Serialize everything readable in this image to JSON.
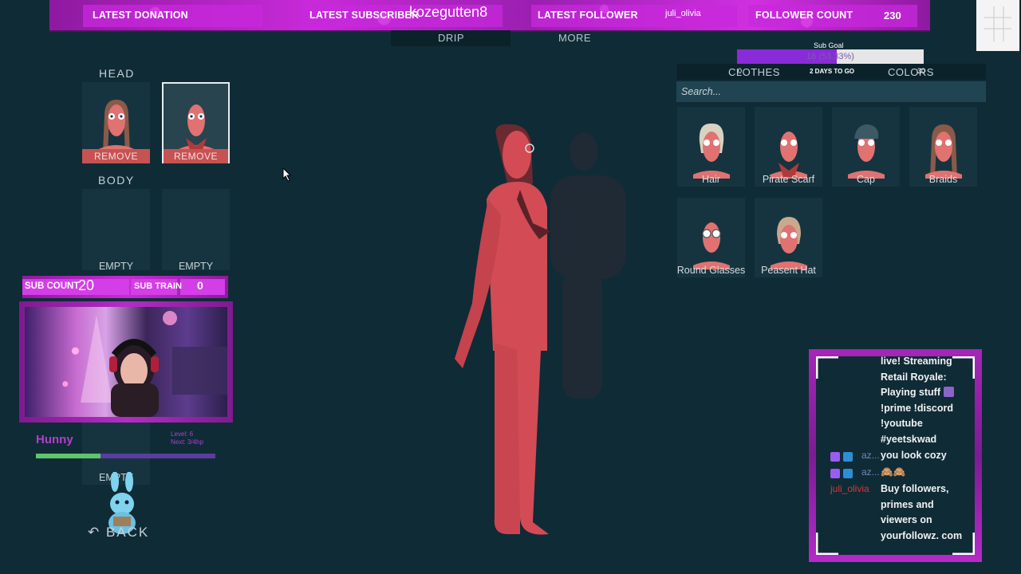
{
  "overlay": {
    "latest_donation_label": "LATEST DONATION",
    "latest_donation_value": "",
    "latest_subscriber_label": "LATEST SUBSCRIBER",
    "latest_subscriber_value": "kozegutten8",
    "latest_follower_label": "LATEST FOLLOWER",
    "latest_follower_value": "juli_olivia",
    "follower_count_label": "FOLLOWER COUNT",
    "follower_count_value": "230",
    "sub_count_label": "SUB COUNT",
    "sub_count_value": "20",
    "sub_train_label": "SUB TRAIN",
    "sub_train_value": "0"
  },
  "game_tabs": {
    "drip": "DRIP",
    "more": "MORE"
  },
  "equipment": {
    "head_title": "HEAD",
    "body_title": "BODY",
    "remove_label": "REMOVE",
    "empty_label": "EMPTY",
    "back_label": "BACK"
  },
  "catalog": {
    "tabs": [
      "CLOTHES",
      "COLORS"
    ],
    "search_placeholder": "Search...",
    "items": [
      "Hair",
      "Pirate Scarf",
      "Cap",
      "Braids",
      "Round Glasses",
      "Peasent Hat"
    ]
  },
  "sub_goal": {
    "title": "Sub Goal",
    "progress_text": "16 (53.33%)",
    "progress_fraction": 0.5333,
    "min": "0",
    "max": "30",
    "days_left": "2 DAYS TO GO"
  },
  "level": {
    "name": "Hunny",
    "line1": "Level: 6",
    "line2": "Next: 3/4hp",
    "xp_fraction": 0.36
  },
  "chat": {
    "messages": [
      {
        "user": "",
        "lines": [
          "live! Streaming",
          "Retail Royale:",
          "Playing stuff",
          "!prime !discord",
          "!youtube",
          "#yeetskwad"
        ]
      },
      {
        "user": "az...",
        "lines": [
          "you look cozy"
        ]
      },
      {
        "user": "az...",
        "lines": [
          "🙈🙈"
        ]
      },
      {
        "user": "juli_olivia",
        "lines": [
          "Buy followers,",
          "primes and",
          "viewers on",
          "yourfollowz. com"
        ]
      }
    ]
  },
  "colors": {
    "accent_magenta": "#c82ad8",
    "remove_red": "#c75252",
    "character_red": "#d24b55",
    "panel_bg": "#0f2b36"
  }
}
